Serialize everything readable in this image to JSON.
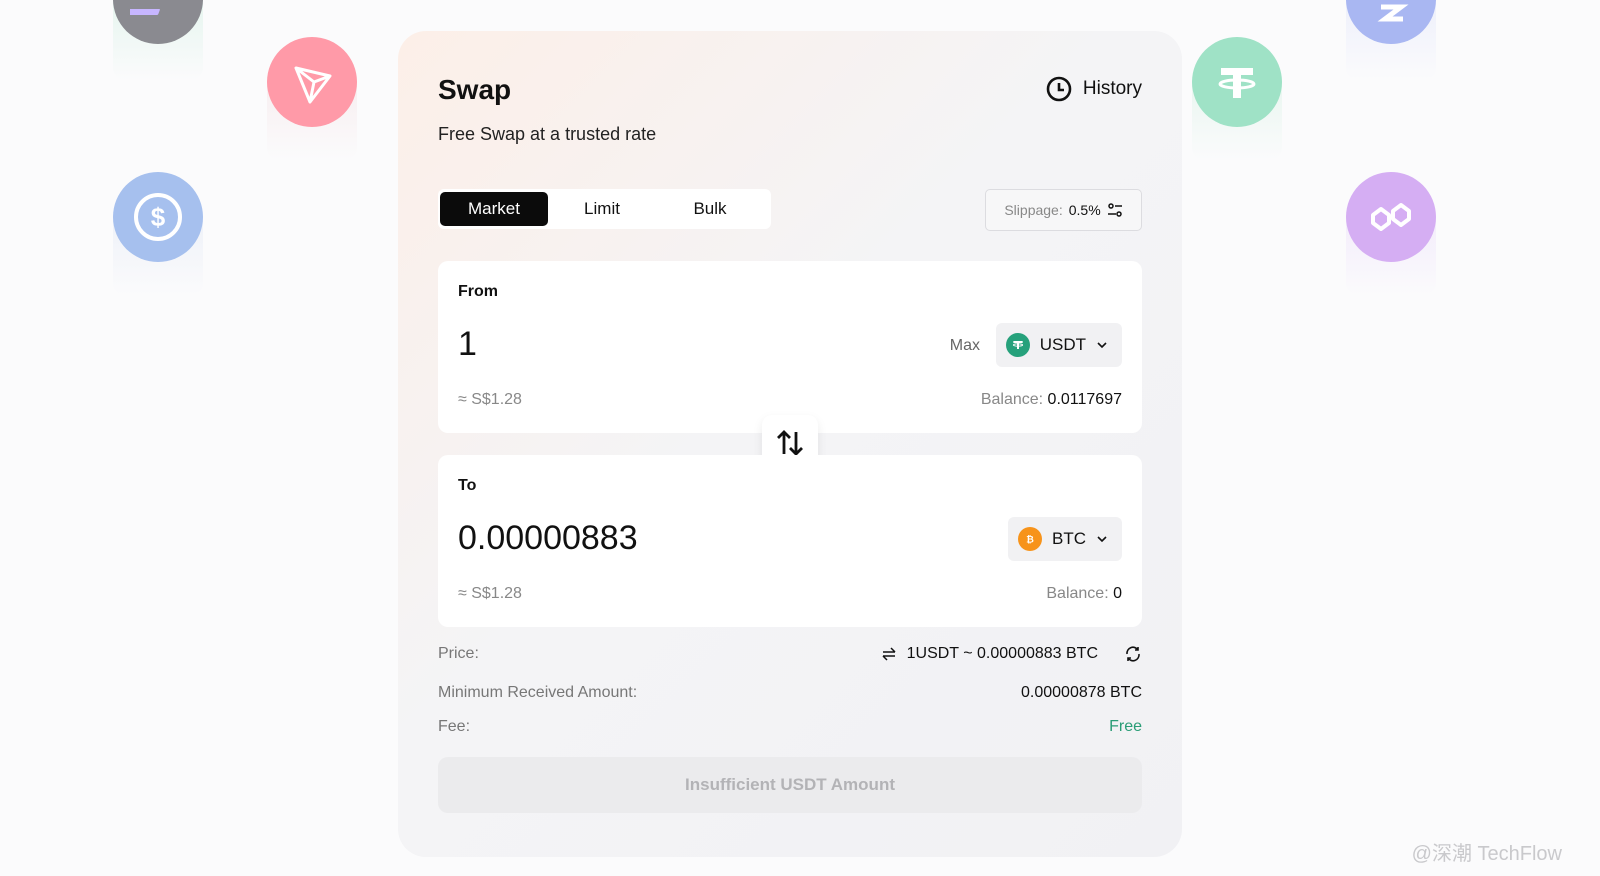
{
  "swap": {
    "title": "Swap",
    "subtitle": "Free Swap at a trusted rate",
    "history_label": "History"
  },
  "tabs": [
    {
      "label": "Market",
      "active": true
    },
    {
      "label": "Limit",
      "active": false
    },
    {
      "label": "Bulk",
      "active": false
    }
  ],
  "slippage": {
    "label": "Slippage:",
    "value": "0.5%"
  },
  "from": {
    "label": "From",
    "amount": "1",
    "max_label": "Max",
    "token": "USDT",
    "fiat": "≈ S$1.28",
    "balance_label": "Balance:",
    "balance_value": "0.0117697"
  },
  "to": {
    "label": "To",
    "amount": "0.00000883",
    "token": "BTC",
    "fiat": "≈ S$1.28",
    "balance_label": "Balance:",
    "balance_value": "0"
  },
  "info": {
    "price_label": "Price:",
    "price_value": "1USDT ~ 0.00000883 BTC",
    "min_label": "Minimum Received Amount:",
    "min_value": "0.00000878 BTC",
    "fee_label": "Fee:",
    "fee_value": "Free"
  },
  "submit_label": "Insufficient USDT Amount",
  "watermark": "@深潮 TechFlow",
  "colors": {
    "usdt": "#26a17b",
    "btc": "#f7931a",
    "free": "#2a9d76",
    "tron": "#ff7c8f",
    "usdc": "#7fa6e8",
    "polygon": "#c88ef0"
  },
  "decorative_icons": [
    "solana-coin-icon",
    "tron-coin-icon",
    "usdc-coin-icon",
    "tether-coin-icon",
    "litecoin-coin-icon",
    "polygon-coin-icon"
  ]
}
